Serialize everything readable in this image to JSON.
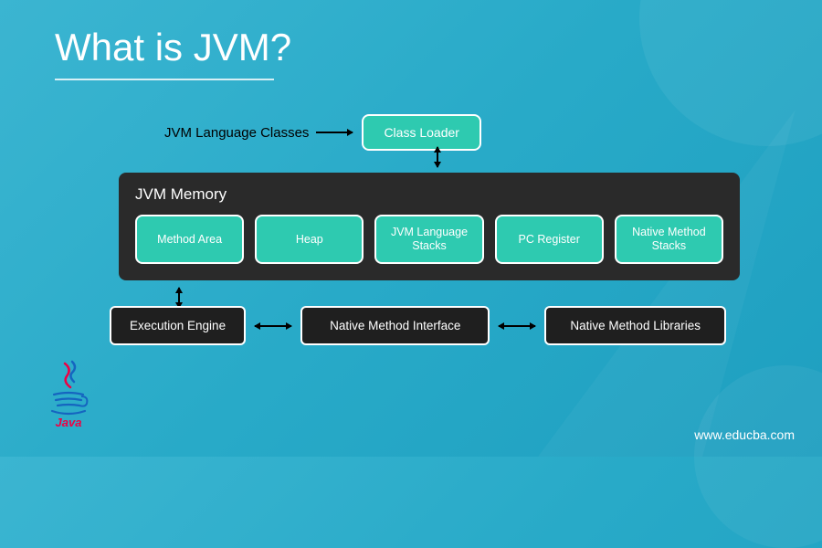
{
  "title": "What is JVM?",
  "top": {
    "label": "JVM Language Classes",
    "class_loader": "Class Loader"
  },
  "memory": {
    "title": "JVM Memory",
    "boxes": [
      "Method Area",
      "Heap",
      "JVM Language Stacks",
      "PC Register",
      "Native Method Stacks"
    ]
  },
  "bottom": {
    "exec": "Execution Engine",
    "nmi": "Native Method Interface",
    "nml": "Native Method Libraries"
  },
  "logo_text": "Java",
  "watermark": "www.educba.com"
}
